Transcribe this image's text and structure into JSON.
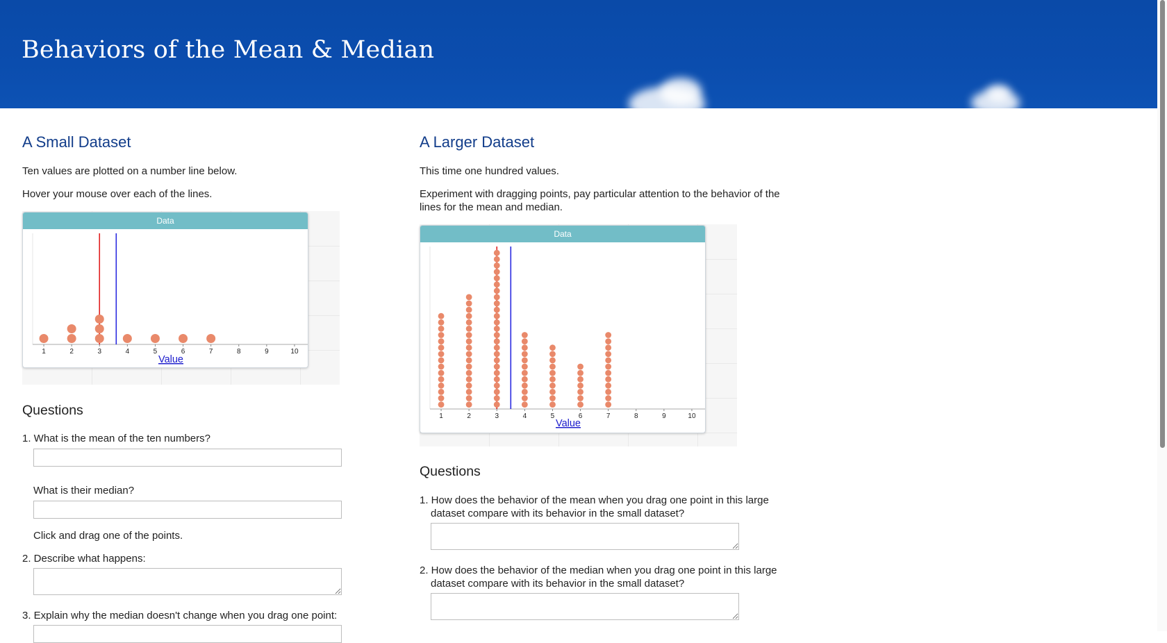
{
  "header": {
    "title": "Behaviors of the Mean & Median"
  },
  "small": {
    "title": "A Small Dataset",
    "intro1": "Ten values are plotted on a number line below.",
    "intro2": "Hover your mouse over each of the lines.",
    "graph_title": "Data",
    "axis_label": "Value",
    "questions_title": "Questions",
    "q1": "1. What is the mean of the ten numbers?",
    "q1b": "What is their median?",
    "instruction": "Click and drag one of the points.",
    "q2": "2. Describe what happens:",
    "q3": "3. Explain why the median doesn't change when you drag one point:"
  },
  "large": {
    "title": "A Larger Dataset",
    "intro1": "This time one hundred values.",
    "intro2": "Experiment with dragging points, pay particular attention to the behavior of the lines for the mean and median.",
    "graph_title": "Data",
    "axis_label": "Value",
    "questions_title": "Questions",
    "q1": "1. How does the behavior of the mean when you drag one point in this large dataset compare with its behavior in the small dataset?",
    "q2": "2. How does the behavior of the median when you drag one point in this large dataset compare with its behavior in the small dataset?"
  },
  "chart_data": [
    {
      "type": "scatter",
      "title": "Data",
      "xlabel": "Value",
      "ylabel": "",
      "x_ticks": [
        1,
        2,
        3,
        4,
        5,
        6,
        7,
        8,
        9,
        10
      ],
      "xlim": [
        0.6,
        10.4
      ],
      "counts": [
        {
          "x": 1,
          "n": 1
        },
        {
          "x": 2,
          "n": 2
        },
        {
          "x": 3,
          "n": 3
        },
        {
          "x": 4,
          "n": 1
        },
        {
          "x": 5,
          "n": 1
        },
        {
          "x": 6,
          "n": 1
        },
        {
          "x": 7,
          "n": 1
        }
      ],
      "mean": 3.6,
      "median": 3,
      "colors": {
        "points": "#e9896a",
        "median_line": "#e02020",
        "mean_line": "#2a2ae0",
        "titlebar": "#72bdc7"
      }
    },
    {
      "type": "scatter",
      "title": "Data",
      "xlabel": "Value",
      "ylabel": "",
      "x_ticks": [
        1,
        2,
        3,
        4,
        5,
        6,
        7,
        8,
        9,
        10
      ],
      "xlim": [
        0.6,
        10.4
      ],
      "counts": [
        {
          "x": 1,
          "n": 15
        },
        {
          "x": 2,
          "n": 18
        },
        {
          "x": 3,
          "n": 25
        },
        {
          "x": 4,
          "n": 12
        },
        {
          "x": 5,
          "n": 10
        },
        {
          "x": 6,
          "n": 7
        },
        {
          "x": 7,
          "n": 12
        }
      ],
      "mean": 3.5,
      "median": 3,
      "colors": {
        "points": "#e9896a",
        "median_line": "#e02020",
        "mean_line": "#2a2ae0",
        "titlebar": "#72bdc7"
      }
    }
  ]
}
